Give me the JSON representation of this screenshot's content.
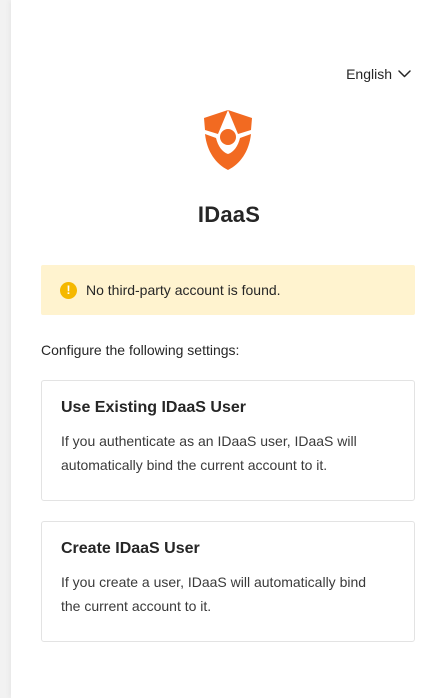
{
  "language": {
    "selected": "English"
  },
  "app": {
    "name": "IDaaS"
  },
  "alert": {
    "message": "No third-party account is found.",
    "icon": "!"
  },
  "instructions": "Configure the following settings:",
  "options": [
    {
      "title": "Use Existing IDaaS User",
      "description": "If you authenticate as an IDaaS user, IDaaS will automatically bind the current account to it."
    },
    {
      "title": "Create IDaaS User",
      "description": "If you create a user, IDaaS will automatically bind the current account to it."
    }
  ],
  "colors": {
    "brand": "#f26a21",
    "alert_bg": "#fff3cf",
    "alert_icon": "#f5b800"
  }
}
